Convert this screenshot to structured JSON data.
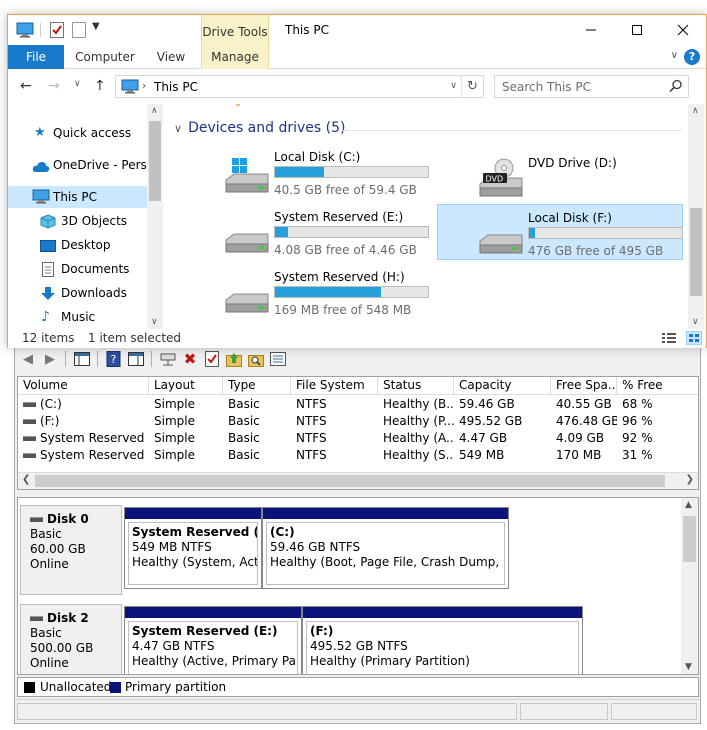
{
  "explorer": {
    "title": "This PC",
    "context_tab": "Drive Tools",
    "ribbon_tabs": {
      "file": "File",
      "computer": "Computer",
      "view": "View",
      "manage": "Manage"
    },
    "address": {
      "location": "This PC"
    },
    "search": {
      "placeholder": "Search This PC"
    },
    "nav": [
      {
        "label": "Quick access",
        "icon": "star-icon"
      },
      {
        "label": "OneDrive - Person",
        "icon": "cloud-icon"
      },
      {
        "label": "This PC",
        "icon": "computer-icon",
        "selected": true
      },
      {
        "label": "3D Objects",
        "icon": "cube-icon"
      },
      {
        "label": "Desktop",
        "icon": "desktop-icon"
      },
      {
        "label": "Documents",
        "icon": "document-icon"
      },
      {
        "label": "Downloads",
        "icon": "download-icon"
      },
      {
        "label": "Music",
        "icon": "music-note-icon"
      }
    ],
    "group_header": "Devices and drives (5)",
    "drives": [
      {
        "name": "Local Disk (C:)",
        "free_text": "40.5 GB free of 59.4 GB",
        "used_fraction": 0.32,
        "icon": "windows-drive-icon"
      },
      {
        "name": "DVD Drive (D:)",
        "free_text": "",
        "used_fraction": null,
        "icon": "dvd-drive-icon",
        "dvd_label": "DVD"
      },
      {
        "name": "System Reserved (E:)",
        "free_text": "4.08 GB free of 4.46 GB",
        "used_fraction": 0.085,
        "icon": "hard-drive-icon"
      },
      {
        "name": "Local Disk (F:)",
        "free_text": "476 GB free of 495 GB",
        "used_fraction": 0.04,
        "icon": "hard-drive-icon",
        "selected": true
      },
      {
        "name": "System Reserved (H:)",
        "free_text": "169 MB free of 548 MB",
        "used_fraction": 0.69,
        "icon": "hard-drive-icon"
      }
    ],
    "status": {
      "items": "12 items",
      "selected": "1 item selected"
    }
  },
  "diskmgmt": {
    "columns": [
      "Volume",
      "Layout",
      "Type",
      "File System",
      "Status",
      "Capacity",
      "Free Spa...",
      "% Free"
    ],
    "rows": [
      [
        "(C:)",
        "Simple",
        "Basic",
        "NTFS",
        "Healthy (B...",
        "59.46 GB",
        "40.55 GB",
        "68 %"
      ],
      [
        "(F:)",
        "Simple",
        "Basic",
        "NTFS",
        "Healthy (P...",
        "495.52 GB",
        "476.48 GB",
        "96 %"
      ],
      [
        "System Reserved (...",
        "Simple",
        "Basic",
        "NTFS",
        "Healthy (A...",
        "4.47 GB",
        "4.09 GB",
        "92 %"
      ],
      [
        "System Reserved (...",
        "Simple",
        "Basic",
        "NTFS",
        "Healthy (S...",
        "549 MB",
        "170 MB",
        "31 %"
      ]
    ],
    "disks": [
      {
        "name": "Disk 0",
        "type": "Basic",
        "size": "60.00 GB",
        "state": "Online",
        "partitions": [
          {
            "title": "System Reserved  (H:)",
            "size": "549 MB NTFS",
            "status": "Healthy (System, Active"
          },
          {
            "title": "(C:)",
            "size": "59.46 GB NTFS",
            "status": "Healthy (Boot, Page File, Crash Dump, Prim"
          }
        ]
      },
      {
        "name": "Disk 2",
        "type": "Basic",
        "size": "500.00 GB",
        "state": "Online",
        "partitions": [
          {
            "title": "System Reserved  (E:)",
            "size": "4.47 GB NTFS",
            "status": "Healthy (Active, Primary Partiti"
          },
          {
            "title": "(F:)",
            "size": "495.52 GB NTFS",
            "status": "Healthy (Primary Partition)"
          }
        ]
      }
    ],
    "legend": {
      "unallocated": "Unallocated",
      "primary": "Primary partition"
    },
    "colors": {
      "unallocated": "#000000",
      "primary": "#0a137a"
    }
  },
  "colors": {
    "accent": "#1979ca",
    "progress": "#26a0da",
    "selection": "#cce8ff",
    "context_tab": "#f9f2c8"
  }
}
